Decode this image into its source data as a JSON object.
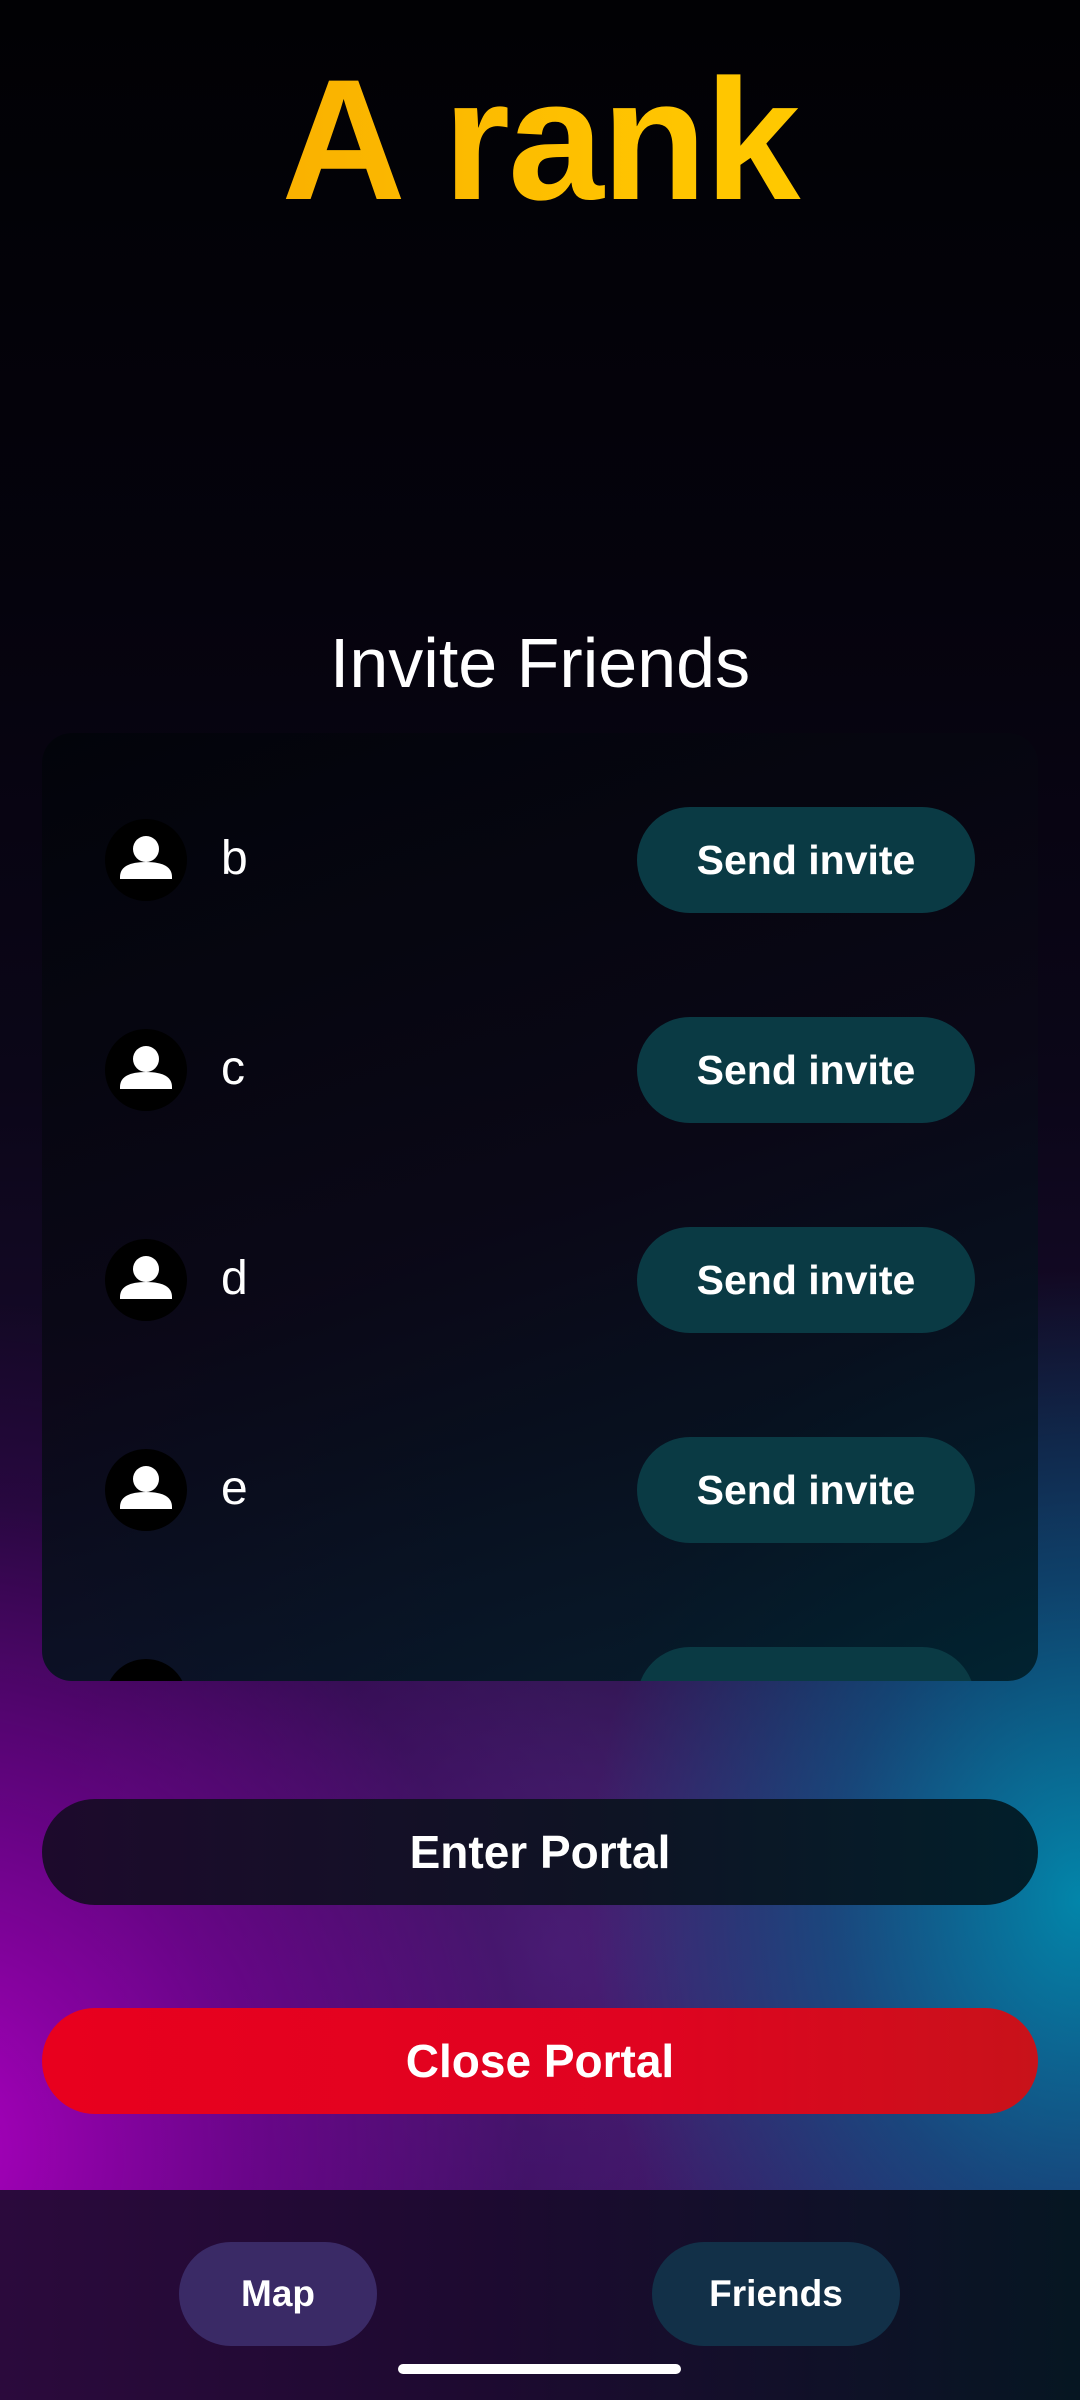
{
  "header": {
    "title": "A rank"
  },
  "invite_section": {
    "title": "Invite Friends",
    "friends": [
      {
        "name": "b",
        "button_label": "Send invite",
        "avatar_icon": "person-icon"
      },
      {
        "name": "c",
        "button_label": "Send invite",
        "avatar_icon": "person-icon"
      },
      {
        "name": "d",
        "button_label": "Send invite",
        "avatar_icon": "person-icon"
      },
      {
        "name": "e",
        "button_label": "Send invite",
        "avatar_icon": "person-icon"
      },
      {
        "name": "",
        "button_label": "",
        "avatar_icon": "person-icon"
      }
    ]
  },
  "actions": {
    "enter_portal": "Enter Portal",
    "close_portal": "Close Portal"
  },
  "bottom_nav": {
    "items": [
      {
        "label": "Map"
      },
      {
        "label": "Friends"
      }
    ]
  },
  "colors": {
    "title_gradient_start": "#f5a300",
    "title_gradient_end": "#ffd000",
    "invite_button": "#0a3a44",
    "close_button": "#e8001e",
    "nav_map": "#3a2a66",
    "nav_friends": "#123048"
  }
}
